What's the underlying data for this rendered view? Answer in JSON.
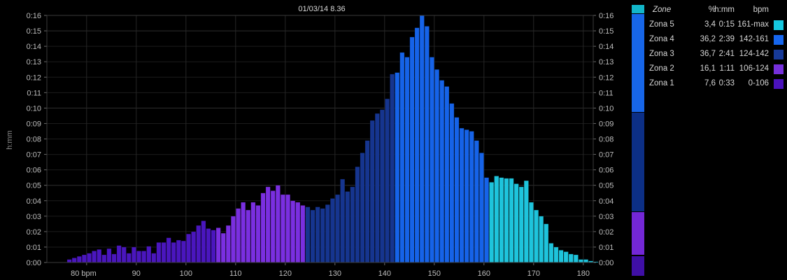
{
  "chart_data": {
    "type": "bar",
    "title": "01/03/14 8.36",
    "ylabel": "h:mm",
    "xlabel": "",
    "x_ticks": [
      "80 bpm",
      "90",
      "100",
      "110",
      "120",
      "130",
      "140",
      "150",
      "160",
      "170",
      "180"
    ],
    "x_tick_values": [
      80,
      90,
      100,
      110,
      120,
      130,
      140,
      150,
      160,
      170,
      180
    ],
    "y_ticks": [
      "0:00",
      "0:01",
      "0:02",
      "0:03",
      "0:04",
      "0:05",
      "0:06",
      "0:07",
      "0:08",
      "0:09",
      "0:10",
      "0:11",
      "0:12",
      "0:13",
      "0:14",
      "0:15",
      "0:16"
    ],
    "xlim": [
      72,
      182
    ],
    "ylim": [
      0,
      16
    ],
    "y_unit": "minutes",
    "bpm_start": 74,
    "values": [
      0,
      0,
      0.2,
      0.3,
      0.4,
      0.5,
      0.6,
      0.75,
      0.85,
      0.5,
      0.9,
      0.55,
      1.1,
      1.0,
      0.6,
      1.0,
      0.75,
      0.75,
      1.05,
      0.6,
      1.3,
      1.3,
      1.6,
      1.3,
      1.45,
      1.4,
      1.85,
      2.0,
      2.4,
      2.7,
      2.2,
      2.1,
      2.25,
      1.9,
      2.4,
      3.0,
      3.5,
      3.9,
      3.4,
      3.9,
      3.7,
      4.5,
      4.9,
      4.65,
      5.0,
      4.4,
      4.4,
      4.0,
      3.9,
      3.7,
      3.6,
      3.4,
      3.6,
      3.5,
      3.75,
      4.15,
      4.4,
      5.4,
      4.6,
      4.9,
      6.2,
      7.1,
      7.9,
      9.2,
      9.65,
      9.9,
      10.6,
      12.2,
      12.3,
      13.6,
      13.3,
      14.6,
      15.2,
      16.0,
      15.3,
      13.3,
      12.5,
      11.8,
      11.4,
      10.3,
      9.4,
      8.7,
      8.6,
      8.5,
      7.9,
      7.1,
      5.5,
      5.2,
      5.6,
      5.5,
      5.45,
      5.45,
      5.1,
      4.9,
      5.3,
      3.9,
      3.4,
      3.0,
      2.5,
      1.25,
      1.0,
      0.8,
      0.7,
      0.55,
      0.5,
      0.2,
      0.2,
      0.1,
      0.05,
      0,
      0
    ],
    "zone_bounds": [
      106,
      124,
      142,
      161
    ],
    "zone_colors": [
      "#4a16be",
      "#7a2fe0",
      "#16358f",
      "#1663e8",
      "#1ec4dc"
    ]
  },
  "legend": {
    "headers": {
      "zone": "Zone",
      "pct": "%",
      "hmm": "h:mm",
      "bpm": "bpm"
    },
    "rows": [
      {
        "zone": "Zona 5",
        "pct": "3,4",
        "hmm": "0:15",
        "bpm": "161-max",
        "color": "#16c8e0"
      },
      {
        "zone": "Zona 4",
        "pct": "36,2",
        "hmm": "2:39",
        "bpm": "142-161",
        "color": "#1666ee"
      },
      {
        "zone": "Zona 3",
        "pct": "36,7",
        "hmm": "2:41",
        "bpm": "124-142",
        "color": "#173a98"
      },
      {
        "zone": "Zona 2",
        "pct": "16,1",
        "hmm": "1:11",
        "bpm": "106-124",
        "color": "#7630dc"
      },
      {
        "zone": "Zona 1",
        "pct": "7,6",
        "hmm": "0:33",
        "bpm": "0-106",
        "color": "#4a12bc"
      }
    ]
  },
  "zone_bar": {
    "colors": [
      "#12b6c9",
      "#1766e8",
      "#0c2f86",
      "#7327d6",
      "#3f0fa6"
    ],
    "weights": [
      3.4,
      36.2,
      36.7,
      16.1,
      7.6
    ]
  }
}
